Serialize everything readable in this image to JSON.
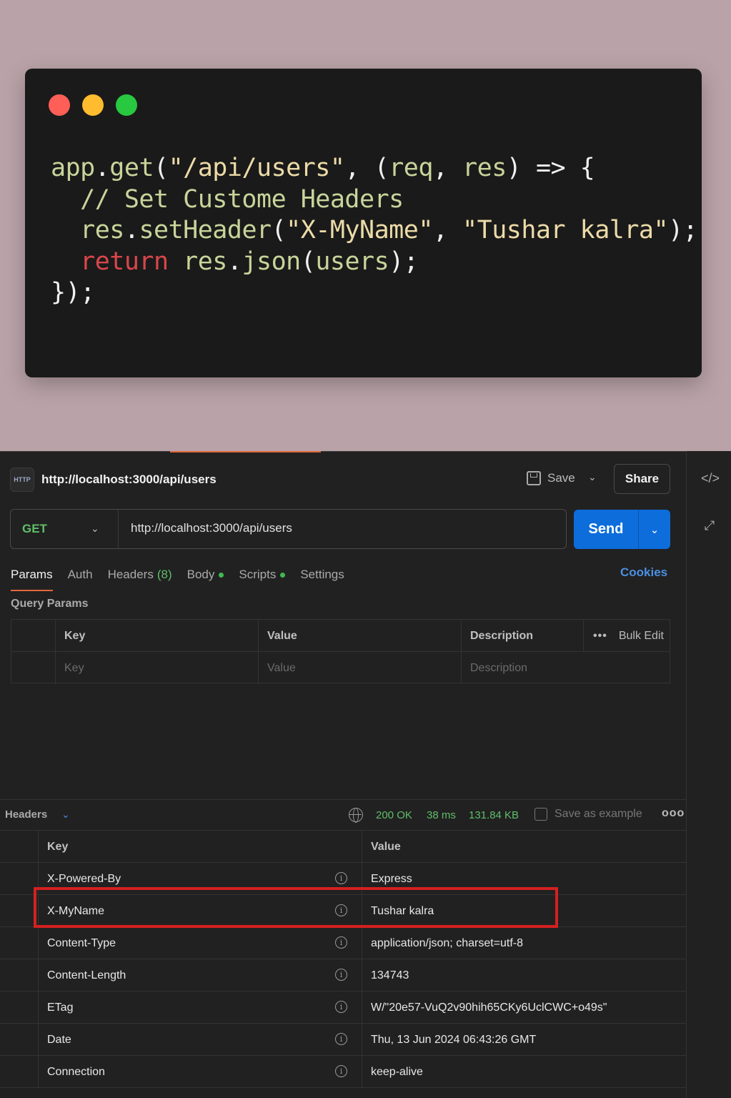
{
  "code_card": {
    "lines": [
      [
        {
          "t": "app",
          "c": "c-fn"
        },
        {
          "t": ".",
          "c": "c-p"
        },
        {
          "t": "get",
          "c": "c-fn"
        },
        {
          "t": "(",
          "c": "c-p"
        },
        {
          "t": "\"/api/users\"",
          "c": "c-str"
        },
        {
          "t": ", ",
          "c": "c-p"
        },
        {
          "t": "(",
          "c": "c-p"
        },
        {
          "t": "req",
          "c": "c-param"
        },
        {
          "t": ", ",
          "c": "c-p"
        },
        {
          "t": "res",
          "c": "c-param"
        },
        {
          "t": ") => {",
          "c": "c-p"
        }
      ],
      [
        {
          "t": "  // Set Custome Headers",
          "c": "c-cm"
        }
      ],
      [
        {
          "t": "  res",
          "c": "c-fn"
        },
        {
          "t": ".",
          "c": "c-p"
        },
        {
          "t": "setHeader",
          "c": "c-fn"
        },
        {
          "t": "(",
          "c": "c-p"
        },
        {
          "t": "\"X-MyName\"",
          "c": "c-str"
        },
        {
          "t": ", ",
          "c": "c-p"
        },
        {
          "t": "\"Tushar kalra\"",
          "c": "c-str"
        },
        {
          "t": ");",
          "c": "c-p"
        }
      ],
      [
        {
          "t": "  return ",
          "c": "c-kw"
        },
        {
          "t": "res",
          "c": "c-fn"
        },
        {
          "t": ".",
          "c": "c-p"
        },
        {
          "t": "json",
          "c": "c-fn"
        },
        {
          "t": "(",
          "c": "c-p"
        },
        {
          "t": "users",
          "c": "c-param"
        },
        {
          "t": ");",
          "c": "c-p"
        }
      ],
      [
        {
          "t": "});",
          "c": "c-p"
        }
      ]
    ]
  },
  "request": {
    "icon_text": "HTTP",
    "title": "http://localhost:3000/api/users",
    "save_label": "Save",
    "share_label": "Share",
    "method": "GET",
    "url": "http://localhost:3000/api/users",
    "send_label": "Send"
  },
  "tabs": [
    {
      "label": "Params",
      "active": true
    },
    {
      "label": "Auth"
    },
    {
      "label": "Headers",
      "count": "(8)"
    },
    {
      "label": "Body",
      "dot": true
    },
    {
      "label": "Scripts",
      "dot": true
    },
    {
      "label": "Settings"
    }
  ],
  "cookies_label": "Cookies",
  "query_params": {
    "title": "Query Params",
    "headers": {
      "key": "Key",
      "value": "Value",
      "description": "Description",
      "bulk_edit": "Bulk Edit",
      "more": "•••"
    },
    "placeholders": {
      "key": "Key",
      "value": "Value",
      "description": "Description"
    }
  },
  "response": {
    "section_label": "Headers",
    "status": "200 OK",
    "time": "38 ms",
    "size": "131.84 KB",
    "save_example": "Save as example",
    "more": "ooo",
    "columns": {
      "key": "Key",
      "value": "Value"
    },
    "headers": [
      {
        "key": "X-Powered-By",
        "value": "Express"
      },
      {
        "key": "X-MyName",
        "value": "Tushar kalra"
      },
      {
        "key": "Content-Type",
        "value": "application/json; charset=utf-8"
      },
      {
        "key": "Content-Length",
        "value": "134743"
      },
      {
        "key": "ETag",
        "value": "W/\"20e57-VuQ2v90hih65CKy6UclCWC+o49s\""
      },
      {
        "key": "Date",
        "value": "Thu, 13 Jun 2024 06:43:26 GMT"
      },
      {
        "key": "Connection",
        "value": "keep-alive"
      }
    ]
  },
  "colors": {
    "accent_orange": "#e2683c",
    "send_blue": "#0d6ddb",
    "status_green": "#5fbe6a",
    "highlight_red": "#d42020"
  }
}
